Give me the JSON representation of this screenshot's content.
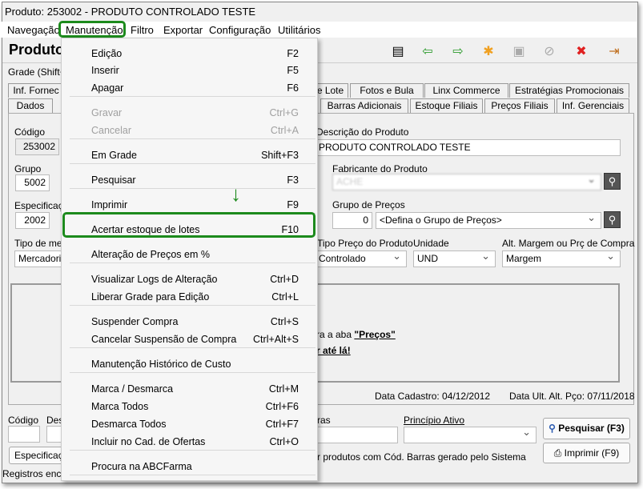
{
  "window": {
    "title": "Produto: 253002 - PRODUTO CONTROLADO TESTE"
  },
  "menubar": [
    "Navegação",
    "Manutenção",
    "Filtro",
    "Exportar",
    "Configuração",
    "Utilitários"
  ],
  "page_title": "Produto",
  "grade_label": "Grade (Shift+",
  "toolbar_icons": [
    "copy-icon",
    "arrow-left-icon",
    "arrow-right-icon",
    "new-icon",
    "save-icon",
    "cancel-icon",
    "delete-icon",
    "exit-icon"
  ],
  "tabs_row1": [
    "Inf. Fornec",
    "e Lote",
    "Fotos e Bula",
    "Linx Commerce",
    "Estratégias Promocionais"
  ],
  "tabs_row2": [
    "Dados",
    "Barras Adicionais",
    "Estoque Filiais",
    "Preços Filiais",
    "Inf. Gerenciais"
  ],
  "form": {
    "codigo_label": "Código",
    "codigo": "253002",
    "grupo_label": "Grupo",
    "grupo": "5002",
    "espec_label": "Especificaç",
    "espec": "2002",
    "tipo_merc_label": "Tipo de mer",
    "tipo_merc": "Mercadoria",
    "descricao_label": "Descrição do Produto",
    "descricao": "PRODUTO CONTROLADO TESTE",
    "fabricante_label": "Fabricante do Produto",
    "fabricante": "ACHE",
    "grupo_precos_label": "Grupo de Preços",
    "grupo_precos_code": "0",
    "grupo_precos": "<Defina o Grupo de Preços>",
    "tipo_preco_label": "Tipo Preço do Produto",
    "tipo_preco": "Controlado",
    "unidade_label": "Unidade",
    "unidade": "UND",
    "alt_margem_label": "Alt. Margem ou Prç de Compra",
    "alt_margem": "Margem",
    "msg1_prefix": "ra a aba",
    "msg1_link": "\"Preços\"",
    "msg2_link": "r até lá!",
    "data_cadastro": "Data Cadastro:  04/12/2012",
    "data_ult": "Data Ult. Alt. Pço:  07/11/2018"
  },
  "search": {
    "codigo_label": "Código",
    "desc_label": "Des",
    "barras_label": "ras",
    "principio_label": "Princípio Ativo",
    "espec_button": "Especificaç",
    "barras_text": "r produtos com Cód. Barras gerado pelo Sistema",
    "pesquisar": "Pesquisar (F3)",
    "imprimir": "Imprimir (F9)"
  },
  "status": "Registros enc",
  "menu": [
    {
      "label": "Edição",
      "key": "F2"
    },
    {
      "label": "Inserir",
      "key": "F5"
    },
    {
      "label": "Apagar",
      "key": "F6"
    },
    {
      "label": "Gravar",
      "key": "Ctrl+G",
      "disabled": true
    },
    {
      "label": "Cancelar",
      "key": "Ctrl+A",
      "disabled": true
    },
    {
      "label": "Em Grade",
      "key": "Shift+F3"
    },
    {
      "label": "Pesquisar",
      "key": "F3"
    },
    {
      "label": "Imprimir",
      "key": "F9"
    },
    {
      "label": "Acertar estoque de lotes",
      "key": "F10"
    },
    {
      "label": "Alteração de Preços em %",
      "key": ""
    },
    {
      "label": "Visualizar Logs de Alteração",
      "key": "Ctrl+D"
    },
    {
      "label": "Liberar Grade para Edição",
      "key": "Ctrl+L"
    },
    {
      "label": "Suspender Compra",
      "key": "Ctrl+S"
    },
    {
      "label": "Cancelar Suspensão de Compra",
      "key": "Ctrl+Alt+S"
    },
    {
      "label": "Manutenção Histórico de Custo",
      "key": ""
    },
    {
      "label": "Marca / Desmarca",
      "key": "Ctrl+M"
    },
    {
      "label": "Marca Todos",
      "key": "Ctrl+F6"
    },
    {
      "label": "Desmarca Todos",
      "key": "Ctrl+F7"
    },
    {
      "label": "Incluir no Cad. de Ofertas",
      "key": "Ctrl+O"
    },
    {
      "label": "Procura na ABCFarma",
      "key": ""
    }
  ],
  "highlight_color": "#1c8a1c"
}
